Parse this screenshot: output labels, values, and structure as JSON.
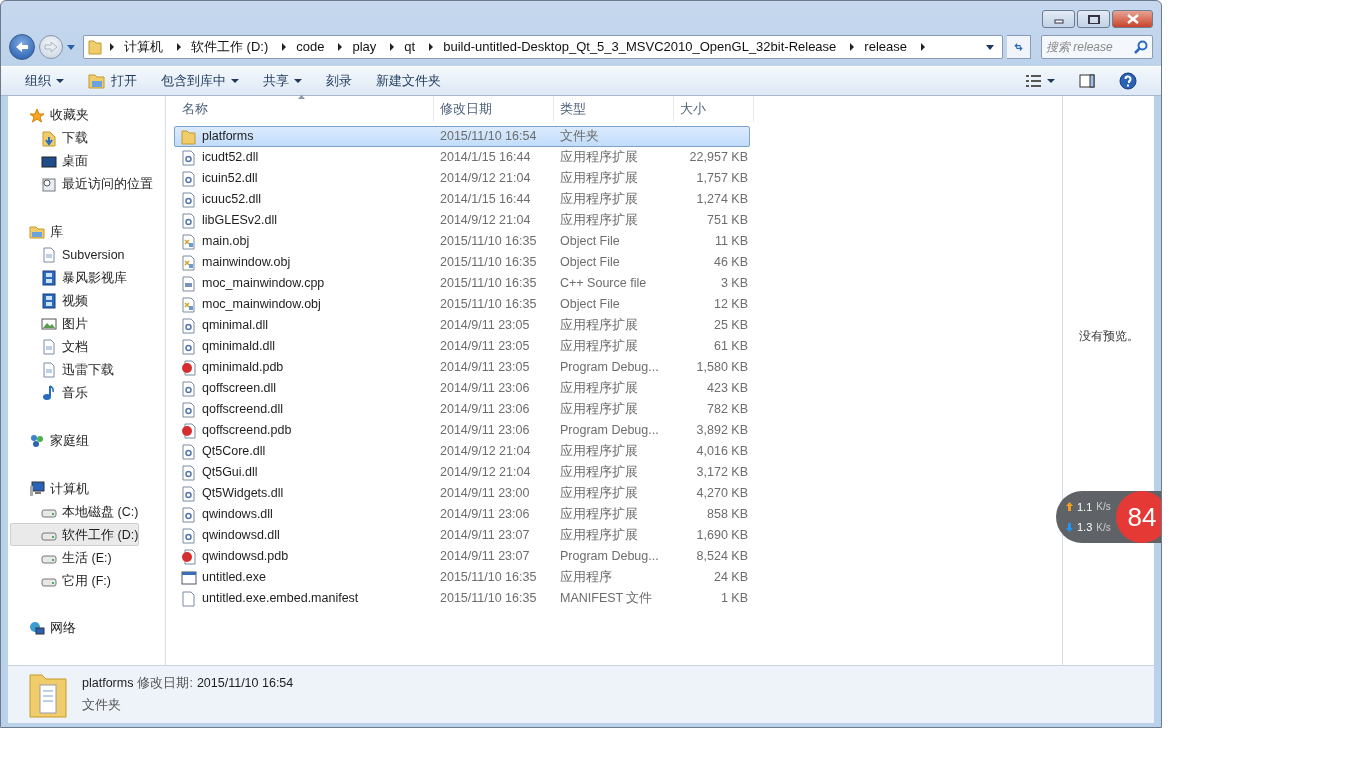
{
  "address_bar": {
    "crumbs": [
      "计算机",
      "软件工作 (D:)",
      "code",
      "play",
      "qt",
      "build-untitled-Desktop_Qt_5_3_MSVC2010_OpenGL_32bit-Release",
      "release"
    ]
  },
  "search": {
    "placeholder": "搜索 release"
  },
  "toolbar": [
    {
      "label": "组织",
      "kind": "menu"
    },
    {
      "label": "打开",
      "kind": "open"
    },
    {
      "label": "包含到库中",
      "kind": "menu"
    },
    {
      "label": "共享",
      "kind": "menu"
    },
    {
      "label": "刻录",
      "kind": "plain"
    },
    {
      "label": "新建文件夹",
      "kind": "plain"
    }
  ],
  "sidebar": [
    {
      "label": "收藏夹",
      "kind": "star",
      "selected": false,
      "children": [
        {
          "label": "下载",
          "kind": "download",
          "selected": false
        },
        {
          "label": "桌面",
          "kind": "desktop",
          "selected": false
        },
        {
          "label": "最近访问的位置",
          "kind": "recent",
          "selected": false
        }
      ]
    },
    {
      "label": "库",
      "kind": "library",
      "selected": false,
      "children": [
        {
          "label": "Subversion",
          "kind": "doc",
          "selected": false
        },
        {
          "label": "暴风影视库",
          "kind": "film",
          "selected": false
        },
        {
          "label": "视频",
          "kind": "film",
          "selected": false
        },
        {
          "label": "图片",
          "kind": "picture",
          "selected": false
        },
        {
          "label": "文档",
          "kind": "doc",
          "selected": false
        },
        {
          "label": "迅雷下载",
          "kind": "doc",
          "selected": false
        },
        {
          "label": "音乐",
          "kind": "music",
          "selected": false
        }
      ]
    },
    {
      "label": "家庭组",
      "kind": "homegroup",
      "selected": false
    },
    {
      "label": "计算机",
      "kind": "computer",
      "selected": false,
      "children": [
        {
          "label": "本地磁盘 (C:)",
          "kind": "drive",
          "selected": false
        },
        {
          "label": "软件工作 (D:)",
          "kind": "drive",
          "selected": true
        },
        {
          "label": "生活 (E:)",
          "kind": "drive",
          "selected": false
        },
        {
          "label": "它用 (F:)",
          "kind": "drive",
          "selected": false
        }
      ]
    },
    {
      "label": "网络",
      "kind": "network",
      "selected": false
    }
  ],
  "table": {
    "columns": [
      "名称",
      "修改日期",
      "类型",
      "大小"
    ],
    "rows": [
      {
        "name": "platforms",
        "date": "2015/11/10 16:54",
        "type": "文件夹",
        "kind": "folder",
        "selected": true
      },
      {
        "name": "icudt52.dll",
        "date": "2014/1/15 16:44",
        "type": "应用程序扩展",
        "size": "22,957 KB",
        "kind": "dll",
        "selected": false
      },
      {
        "name": "icuin52.dll",
        "date": "2014/9/12 21:04",
        "type": "应用程序扩展",
        "size": "1,757 KB",
        "kind": "dll",
        "selected": false
      },
      {
        "name": "icuuc52.dll",
        "date": "2014/1/15 16:44",
        "type": "应用程序扩展",
        "size": "1,274 KB",
        "kind": "dll",
        "selected": false
      },
      {
        "name": "libGLESv2.dll",
        "date": "2014/9/12 21:04",
        "type": "应用程序扩展",
        "size": "751 KB",
        "kind": "dll",
        "selected": false
      },
      {
        "name": "main.obj",
        "date": "2015/11/10 16:35",
        "type": "Object File",
        "size": "11 KB",
        "kind": "obj",
        "selected": false
      },
      {
        "name": "mainwindow.obj",
        "date": "2015/11/10 16:35",
        "type": "Object File",
        "size": "46 KB",
        "kind": "obj",
        "selected": false
      },
      {
        "name": "moc_mainwindow.cpp",
        "date": "2015/11/10 16:35",
        "type": "C++ Source file",
        "size": "3 KB",
        "kind": "cpp",
        "selected": false
      },
      {
        "name": "moc_mainwindow.obj",
        "date": "2015/11/10 16:35",
        "type": "Object File",
        "size": "12 KB",
        "kind": "obj",
        "selected": false
      },
      {
        "name": "qminimal.dll",
        "date": "2014/9/11 23:05",
        "type": "应用程序扩展",
        "size": "25 KB",
        "kind": "dll",
        "selected": false
      },
      {
        "name": "qminimald.dll",
        "date": "2014/9/11 23:05",
        "type": "应用程序扩展",
        "size": "61 KB",
        "kind": "dll",
        "selected": false
      },
      {
        "name": "qminimald.pdb",
        "date": "2014/9/11 23:05",
        "type": "Program Debug...",
        "size": "1,580 KB",
        "kind": "pdb",
        "selected": false
      },
      {
        "name": "qoffscreen.dll",
        "date": "2014/9/11 23:06",
        "type": "应用程序扩展",
        "size": "423 KB",
        "kind": "dll",
        "selected": false
      },
      {
        "name": "qoffscreend.dll",
        "date": "2014/9/11 23:06",
        "type": "应用程序扩展",
        "size": "782 KB",
        "kind": "dll",
        "selected": false
      },
      {
        "name": "qoffscreend.pdb",
        "date": "2014/9/11 23:06",
        "type": "Program Debug...",
        "size": "3,892 KB",
        "kind": "pdb",
        "selected": false
      },
      {
        "name": "Qt5Core.dll",
        "date": "2014/9/12 21:04",
        "type": "应用程序扩展",
        "size": "4,016 KB",
        "kind": "dll",
        "selected": false
      },
      {
        "name": "Qt5Gui.dll",
        "date": "2014/9/12 21:04",
        "type": "应用程序扩展",
        "size": "3,172 KB",
        "kind": "dll",
        "selected": false
      },
      {
        "name": "Qt5Widgets.dll",
        "date": "2014/9/11 23:00",
        "type": "应用程序扩展",
        "size": "4,270 KB",
        "kind": "dll",
        "selected": false
      },
      {
        "name": "qwindows.dll",
        "date": "2014/9/11 23:06",
        "type": "应用程序扩展",
        "size": "858 KB",
        "kind": "dll",
        "selected": false
      },
      {
        "name": "qwindowsd.dll",
        "date": "2014/9/11 23:07",
        "type": "应用程序扩展",
        "size": "1,690 KB",
        "kind": "dll",
        "selected": false
      },
      {
        "name": "qwindowsd.pdb",
        "date": "2014/9/11 23:07",
        "type": "Program Debug...",
        "size": "8,524 KB",
        "kind": "pdb",
        "selected": false
      },
      {
        "name": "untitled.exe",
        "date": "2015/11/10 16:35",
        "type": "应用程序",
        "size": "24 KB",
        "kind": "exe",
        "selected": false
      },
      {
        "name": "untitled.exe.embed.manifest",
        "date": "2015/11/10 16:35",
        "type": "MANIFEST 文件",
        "size": "1 KB",
        "kind": "manifest",
        "selected": false
      }
    ]
  },
  "preview": {
    "text": "没有预览。"
  },
  "details": {
    "name": "platforms",
    "date_label": "修改日期:",
    "date": "2015/11/10 16:54",
    "type": "文件夹"
  },
  "speed_widget": {
    "up": "1.1",
    "up_unit": "K/s",
    "down": "1.3",
    "down_unit": "K/s",
    "percent": "84"
  }
}
